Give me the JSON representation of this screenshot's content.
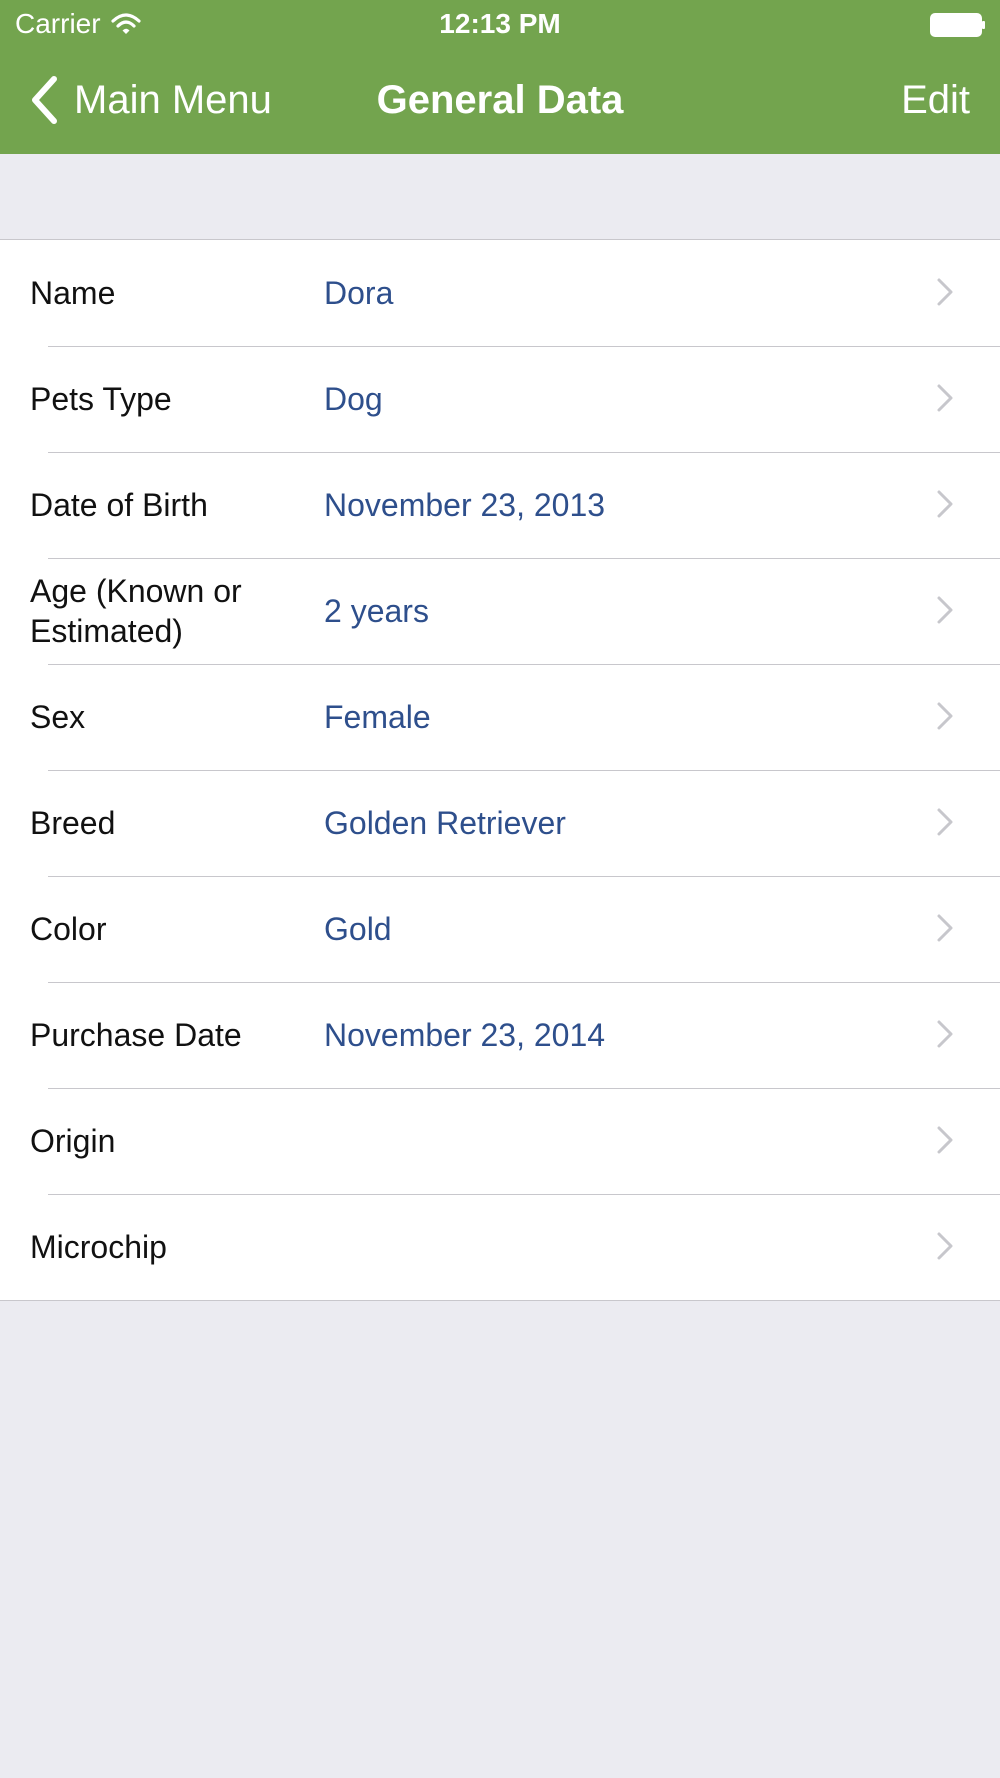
{
  "status_bar": {
    "carrier": "Carrier",
    "time": "12:13 PM",
    "wifi_icon": "wifi-icon",
    "battery_icon": "battery-icon"
  },
  "nav": {
    "back_label": "Main Menu",
    "back_icon": "chevron-left-icon",
    "title": "General Data",
    "edit_label": "Edit"
  },
  "colors": {
    "header_bg": "#73a44e",
    "page_bg": "#ebebf1",
    "value_text": "#2e4f8c",
    "separator": "#c8c7cc",
    "chevron": "#c7c7cc"
  },
  "rows": [
    {
      "label": "Name",
      "value": "Dora"
    },
    {
      "label": "Pets Type",
      "value": "Dog"
    },
    {
      "label": "Date of Birth",
      "value": "November 23, 2013"
    },
    {
      "label": "Age (Known or Estimated)",
      "value": "2 years"
    },
    {
      "label": "Sex",
      "value": "Female"
    },
    {
      "label": "Breed",
      "value": "Golden Retriever"
    },
    {
      "label": "Color",
      "value": "Gold"
    },
    {
      "label": "Purchase Date",
      "value": "November 23, 2014"
    },
    {
      "label": "Origin",
      "value": ""
    },
    {
      "label": "Microchip",
      "value": ""
    }
  ]
}
